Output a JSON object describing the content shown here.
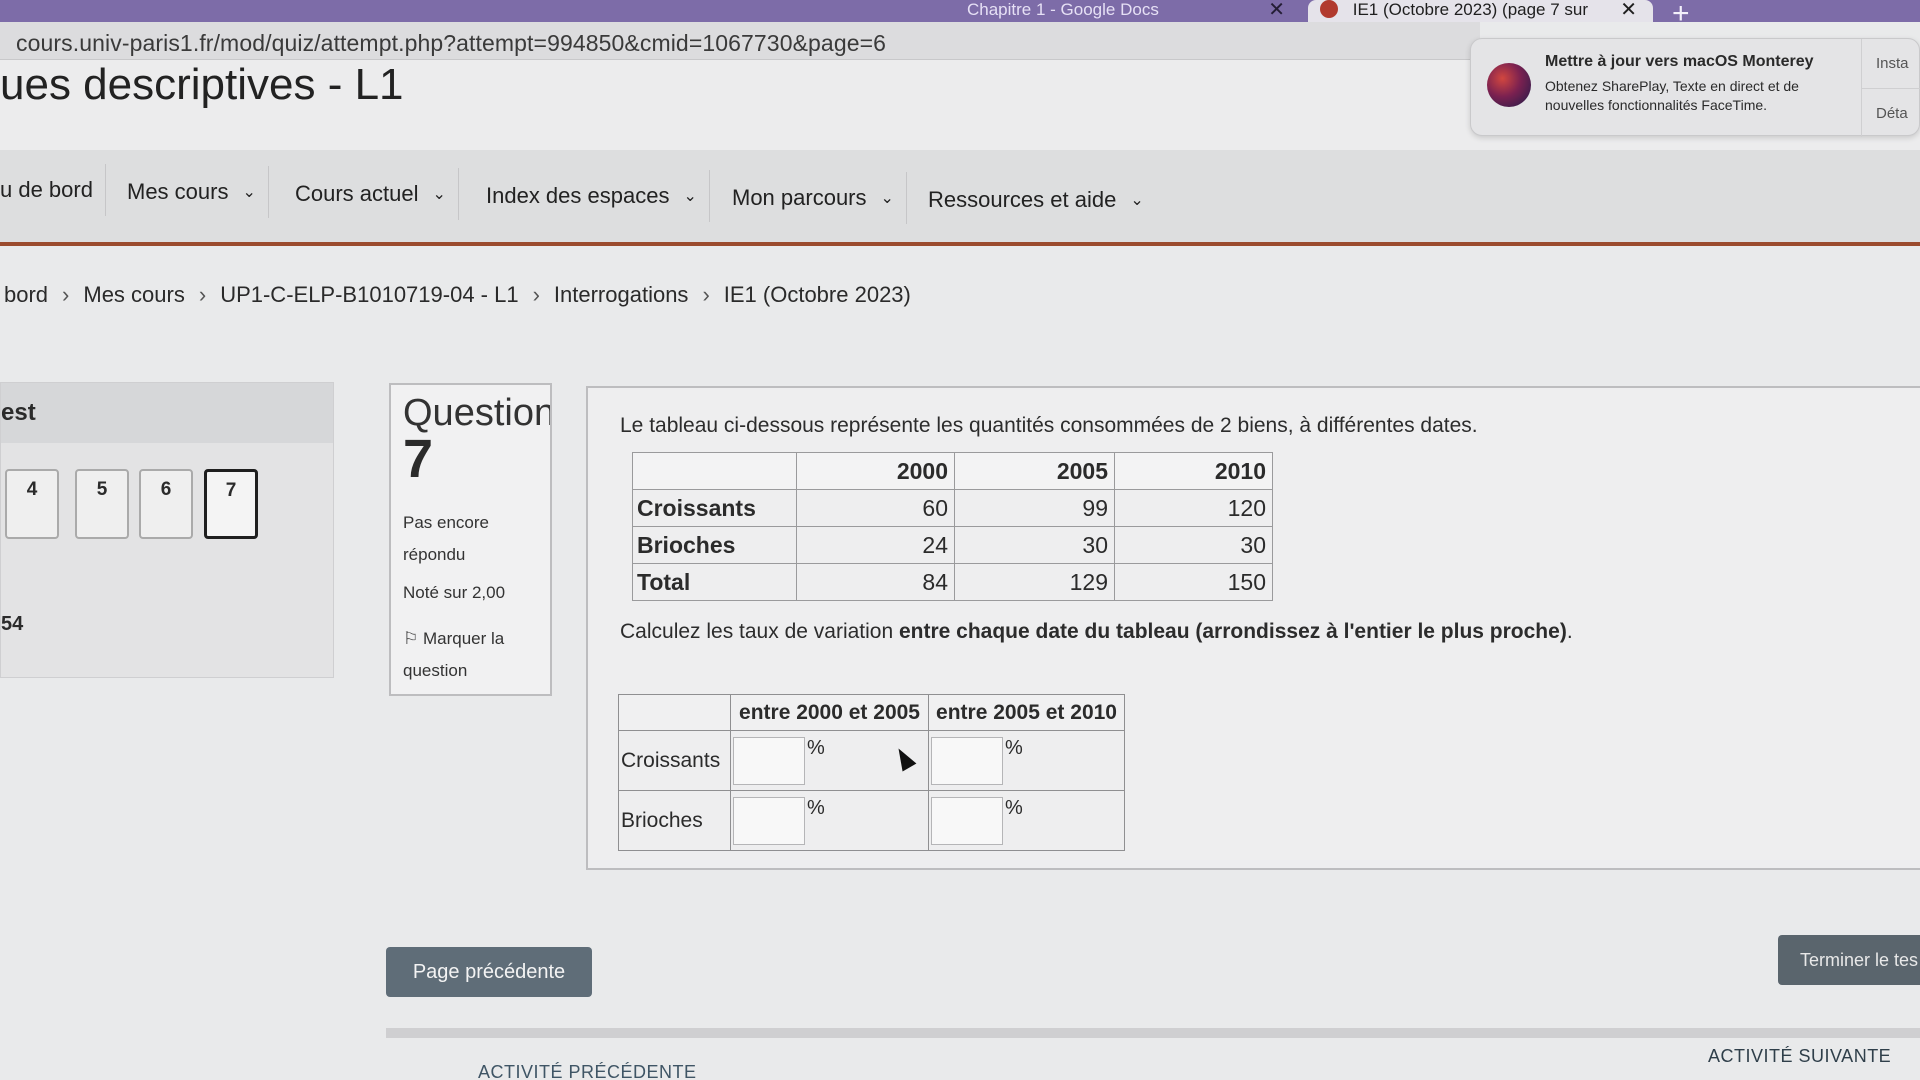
{
  "browser": {
    "tabs": [
      {
        "label": "Chapitre 1 - Google Docs",
        "active": false
      },
      {
        "label": "IE1 (Octobre 2023) (page 7 sur",
        "active": true
      }
    ],
    "url": "cours.univ-paris1.fr/mod/quiz/attempt.php?attempt=994850&cmid=1067730&page=6",
    "new_tab_label": "+"
  },
  "notification": {
    "title": "Mettre à jour vers macOS Monterey",
    "body": "Obtenez SharePlay, Texte en direct et de nouvelles fonctionnalités FaceTime.",
    "install_label": "Insta",
    "details_label": "Déta"
  },
  "header": {
    "title": "ues descriptives - L1"
  },
  "nav": {
    "items": [
      {
        "label": "u de bord"
      },
      {
        "label": "Mes cours"
      },
      {
        "label": "Cours actuel"
      },
      {
        "label": "Index des espaces"
      },
      {
        "label": "Mon parcours"
      },
      {
        "label": "Ressources et aide"
      }
    ]
  },
  "breadcrumb": [
    "bord",
    "Mes cours",
    "UP1-C-ELP-B1010719-04 - L1",
    "Interrogations",
    "IE1 (Octobre 2023)"
  ],
  "quiz_nav": {
    "title": "est",
    "buttons": [
      "4",
      "5",
      "6",
      "7"
    ],
    "current": "7",
    "timer": "54"
  },
  "question_info": {
    "label": "Question",
    "number": "7",
    "state": "Pas encore répondu",
    "grade": "Noté sur 2,00",
    "flag": "Marquer la question"
  },
  "question": {
    "intro": "Le tableau ci-dessous représente les quantités consommées de 2 biens, à différentes dates.",
    "data_table": {
      "headers": [
        "",
        "2000",
        "2005",
        "2010"
      ],
      "rows": [
        {
          "label": "Croissants",
          "values": [
            "60",
            "99",
            "120"
          ]
        },
        {
          "label": "Brioches",
          "values": [
            "24",
            "30",
            "30"
          ]
        },
        {
          "label": "Total",
          "values": [
            "84",
            "129",
            "150"
          ]
        }
      ]
    },
    "instruction_prefix": "Calculez les taux de variation ",
    "instruction_bold": "entre chaque date du tableau (arrondissez à l'entier le plus proche)",
    "instruction_suffix": ".",
    "answer_table": {
      "headers": [
        "",
        "entre 2000 et 2005",
        "entre 2005 et 2010"
      ],
      "rows": [
        {
          "label": "Croissants",
          "inputs": [
            "",
            ""
          ]
        },
        {
          "label": "Brioches",
          "inputs": [
            "",
            ""
          ]
        }
      ],
      "unit": "%"
    }
  },
  "footer": {
    "prev_page": "Page précédente",
    "finish": "Terminer le tes",
    "prev_activity": "ACTIVITÉ PRÉCÉDENTE",
    "next_activity": "ACTIVITÉ SUIVANTE"
  }
}
